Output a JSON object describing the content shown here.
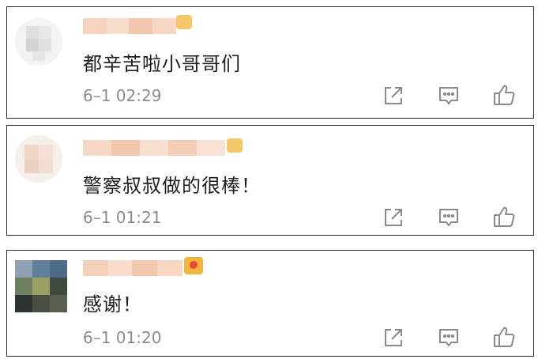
{
  "comments": [
    {
      "text": "都辛苦啦小哥哥们",
      "time": "6–1 02:29"
    },
    {
      "text": "警察叔叔做的很棒！",
      "time": "6–1 01:21"
    },
    {
      "text": "感谢！",
      "time": "6–1 01:20"
    }
  ],
  "actions": [
    {
      "name": "repost",
      "icon": "share-arrow-icon"
    },
    {
      "name": "comment",
      "icon": "comment-bubble-icon"
    },
    {
      "name": "like",
      "icon": "thumbs-up-icon"
    }
  ],
  "colors": {
    "border": "#2a2a2a",
    "text": "#1e1e1e",
    "timestamp": "#8c8c8c",
    "icon": "#8a8a8a",
    "name_blur": "#f4c9b1",
    "crown": "#f0b53c",
    "crown_red": "#e84b35"
  }
}
